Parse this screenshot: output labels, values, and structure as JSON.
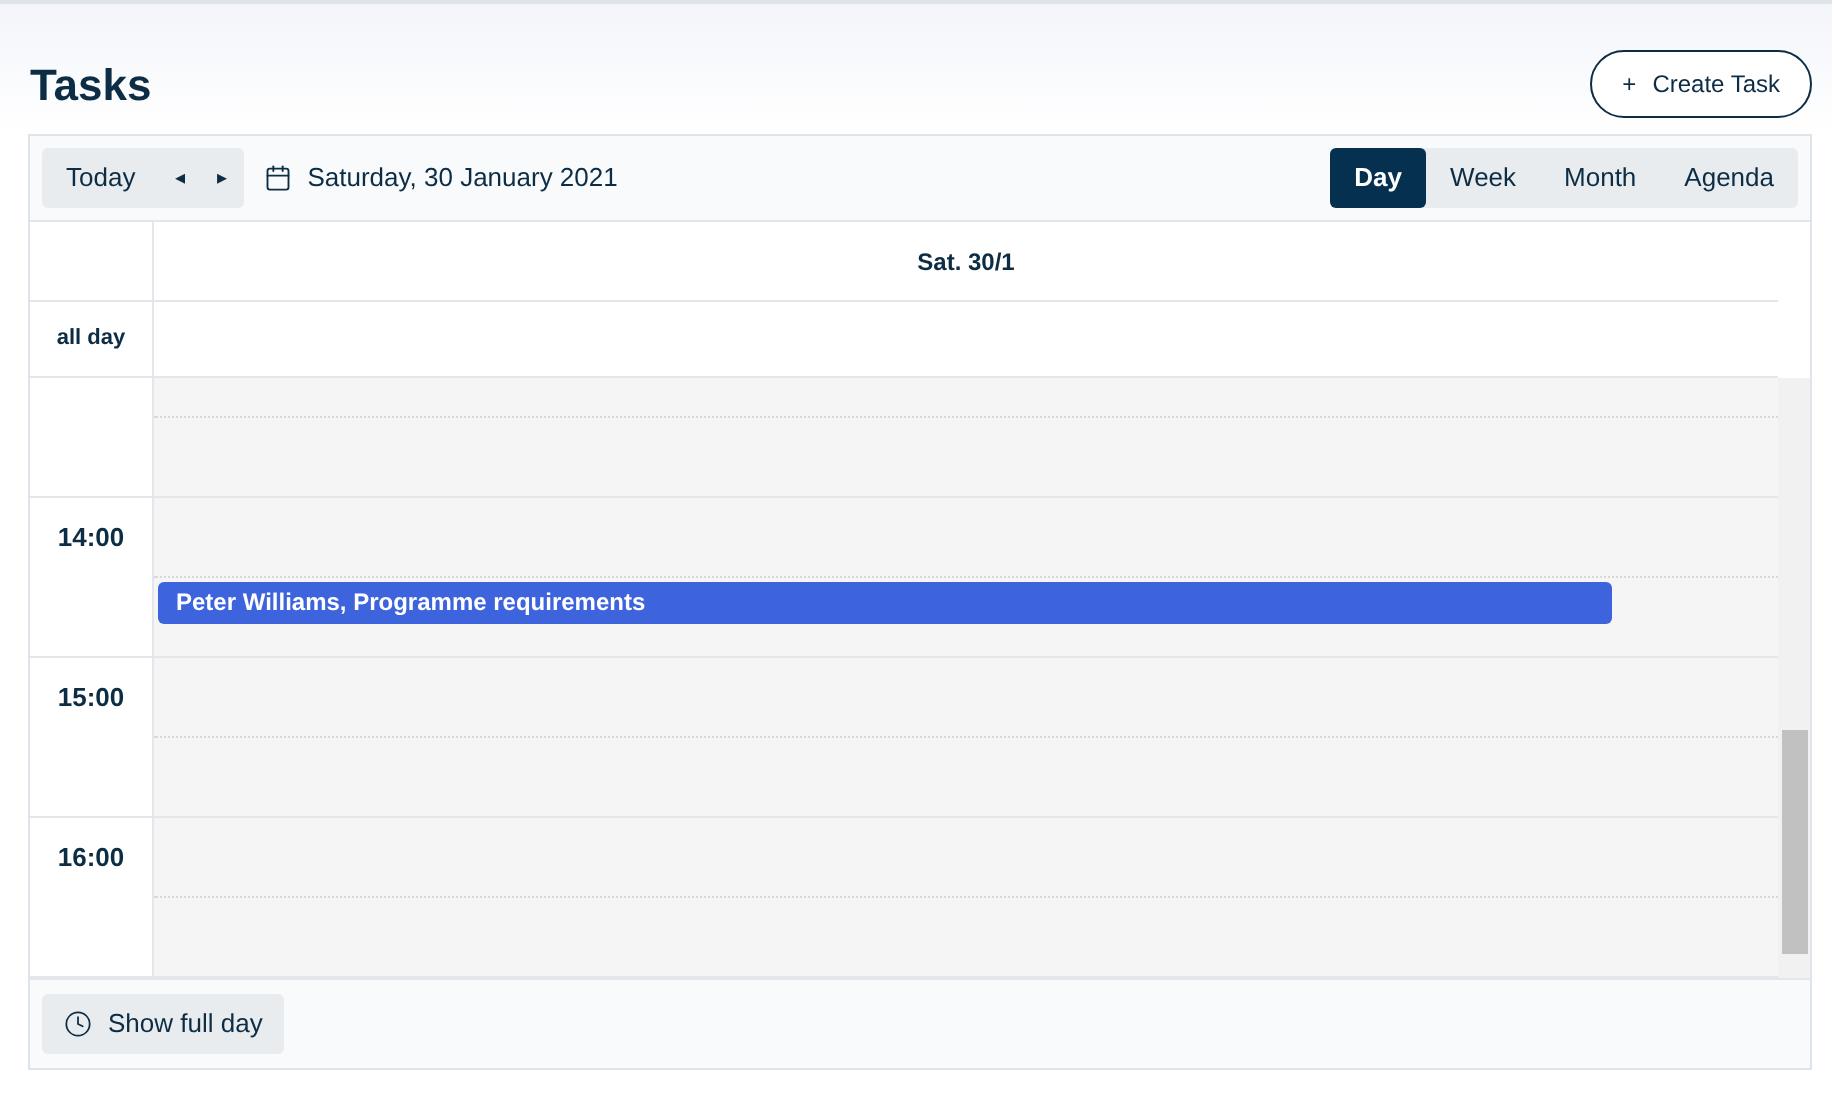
{
  "page": {
    "title": "Tasks"
  },
  "create_button": {
    "label": "Create Task",
    "icon": "+"
  },
  "toolbar": {
    "today": "Today",
    "prev": "◂",
    "next": "▸",
    "date": "Saturday, 30 January 2021",
    "views": [
      {
        "label": "Day",
        "selected": true
      },
      {
        "label": "Week",
        "selected": false
      },
      {
        "label": "Month",
        "selected": false
      },
      {
        "label": "Agenda",
        "selected": false
      }
    ]
  },
  "day_header": "Sat. 30/1",
  "all_day_label": "all day",
  "hours": [
    {
      "label": "14:00",
      "events": [
        {
          "title": "Peter Williams, Programme requirements",
          "color": "#3d63dd"
        }
      ]
    },
    {
      "label": "15:00"
    },
    {
      "label": "16:00"
    }
  ],
  "footer": {
    "button": "Show full day"
  }
}
